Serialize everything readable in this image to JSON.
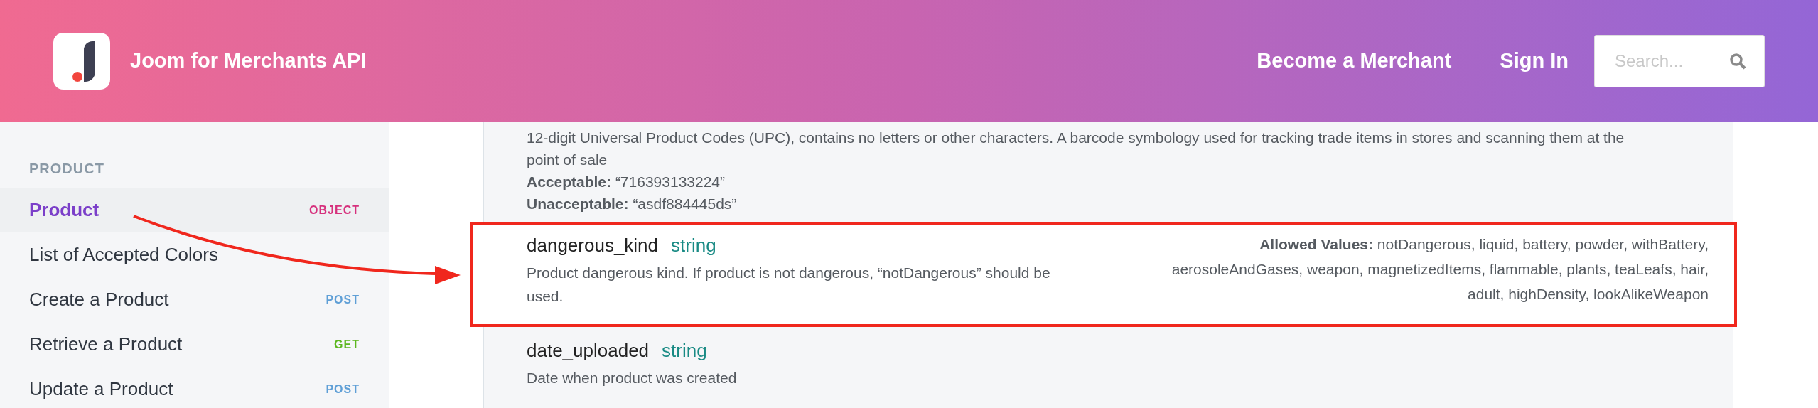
{
  "header": {
    "title": "Joom for Merchants API",
    "nav": [
      "Become a Merchant",
      "Sign In"
    ],
    "search": {
      "placeholder": "Search..."
    }
  },
  "sidebar": {
    "section": "PRODUCT",
    "items": [
      {
        "label": "Product",
        "badge": "OBJECT",
        "kind": "object",
        "selected": true
      },
      {
        "label": "List of Accepted Colors",
        "selected": false
      },
      {
        "label": "Create a Product",
        "badge": "POST",
        "kind": "post",
        "selected": false
      },
      {
        "label": "Retrieve a Product",
        "badge": "GET",
        "kind": "get",
        "selected": false
      },
      {
        "label": "Update a Product",
        "badge": "POST",
        "kind": "post",
        "selected": false
      }
    ]
  },
  "content": {
    "intro": {
      "description": "12-digit Universal Product Codes (UPC), contains no letters or other characters. A barcode symbology used for tracking trade items in stores and scanning them at the point of sale",
      "examples": [
        "**Acceptable:** “716393133224”",
        "**Unacceptable:** “asdf884445ds”"
      ]
    },
    "fields": [
      {
        "name": "dangerous_kind",
        "type": "string",
        "description": "Product dangerous kind. If product is not dangerous, “notDangerous” should be used.",
        "allowed_values": "**Allowed Values:** notDangerous, liquid, battery, powder, withBattery, aerosoleAndGases, weapon, magnetizedItems, flammable, plants, teaLeafs, hair, adult, highDensity, lookAlikeWeapon",
        "highlighted": true
      },
      {
        "name": "date_uploaded",
        "type": "string",
        "description": "Date when product was created",
        "highlighted": false
      }
    ]
  }
}
